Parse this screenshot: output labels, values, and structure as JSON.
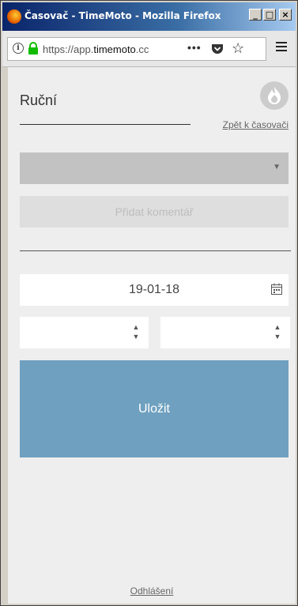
{
  "window": {
    "title": "Časovač - TimeMoto - Mozilla Firefox",
    "minimize": "_",
    "maximize": "□",
    "close": "×"
  },
  "navbar": {
    "info_glyph": "i",
    "url_prefix": "https://app.",
    "url_domain": "timemoto",
    "url_rest": ".cc",
    "more_glyph": "•••",
    "bookmark_glyph": "☆"
  },
  "page": {
    "title": "Ruční",
    "back_link": "Zpět k časovači",
    "dropdown": {
      "selected": "",
      "arrow_glyph": "▼"
    },
    "add_comment_label": "Přidat komentář",
    "date_value": "19-01-18",
    "time_start_value": "",
    "time_end_value": "",
    "stepper_up": "▲",
    "stepper_down": "▼",
    "save_label": "Uložit",
    "logout_link": "Odhlášení"
  }
}
